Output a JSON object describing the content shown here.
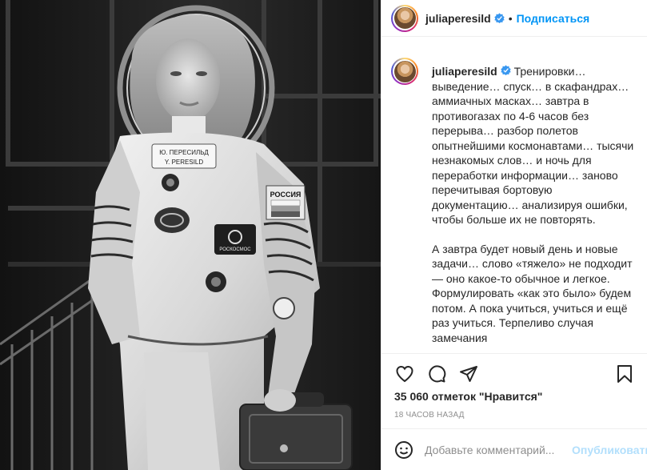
{
  "post": {
    "username": "juliaperesild",
    "follow_label": "Подписаться",
    "separator": "•",
    "photo": {
      "patch_country": "РОССИЯ",
      "patch_agency": "РОСКОСМОС",
      "nametag_line1": "Ю. ПЕРЕСИЛЬД",
      "nametag_line2": "Y. PERESILD"
    },
    "caption": {
      "paragraph1": "Тренировки… выведение… спуск… в скафандрах… аммиачных масках… завтра в противогазах по 4-6 часов без перерыва… разбор полетов опытнейшими космонавтами… тысячи незнакомых слов… и ночь для переработки информации… заново перечитывая бортовую документацию… анализируя ошибки, чтобы больше их не повторять.",
      "paragraph2": "А завтра будет новый день и новые задачи… слово «тяжело» не подходит — оно какое-то обычное и легкое. Формулировать «как это было» будем потом. А пока учиться, учиться и ещё раз учиться. Терпеливо случая замечания"
    },
    "likes": "35 060 отметок \"Нравится\"",
    "timestamp": "18 ЧАСОВ НАЗАД",
    "comment_placeholder": "Добавьте комментарий...",
    "publish_label": "Опубликовать",
    "icons": {
      "like": "heart-icon",
      "comment": "comment-icon",
      "share": "paper-plane-icon",
      "save": "bookmark-icon",
      "emoji": "smiley-icon",
      "verified": "verified-badge-icon"
    },
    "colors": {
      "link_blue": "#0095f6",
      "publish_disabled": "#b2dffc",
      "verified": "#3897f0"
    }
  }
}
